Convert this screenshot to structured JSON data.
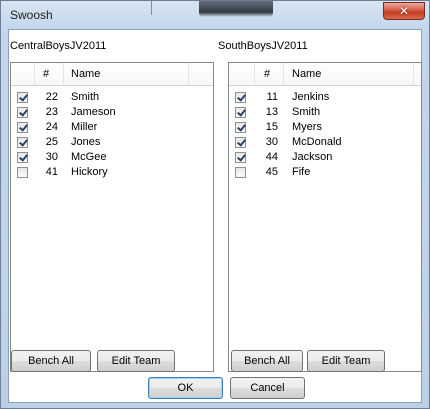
{
  "window": {
    "title": "Swoosh",
    "close_glyph": "✕"
  },
  "teams": [
    {
      "name": "CentralBoysJV2011",
      "columns": {
        "number": "#",
        "name": "Name"
      },
      "players": [
        {
          "checked": true,
          "number": "22",
          "name": "Smith"
        },
        {
          "checked": true,
          "number": "23",
          "name": "Jameson"
        },
        {
          "checked": true,
          "number": "24",
          "name": "Miller"
        },
        {
          "checked": true,
          "number": "25",
          "name": "Jones"
        },
        {
          "checked": true,
          "number": "30",
          "name": "McGee"
        },
        {
          "checked": false,
          "number": "41",
          "name": "Hickory"
        }
      ],
      "bench_all_label": "Bench All",
      "edit_team_label": "Edit Team"
    },
    {
      "name": "SouthBoysJV2011",
      "columns": {
        "number": "#",
        "name": "Name"
      },
      "players": [
        {
          "checked": true,
          "number": "11",
          "name": "Jenkins"
        },
        {
          "checked": true,
          "number": "13",
          "name": "Smith"
        },
        {
          "checked": true,
          "number": "15",
          "name": "Myers"
        },
        {
          "checked": true,
          "number": "30",
          "name": "McDonald"
        },
        {
          "checked": true,
          "number": "44",
          "name": "Jackson"
        },
        {
          "checked": false,
          "number": "45",
          "name": "Fife"
        }
      ],
      "bench_all_label": "Bench All",
      "edit_team_label": "Edit Team"
    }
  ],
  "footer": {
    "ok_label": "OK",
    "cancel_label": "Cancel"
  }
}
